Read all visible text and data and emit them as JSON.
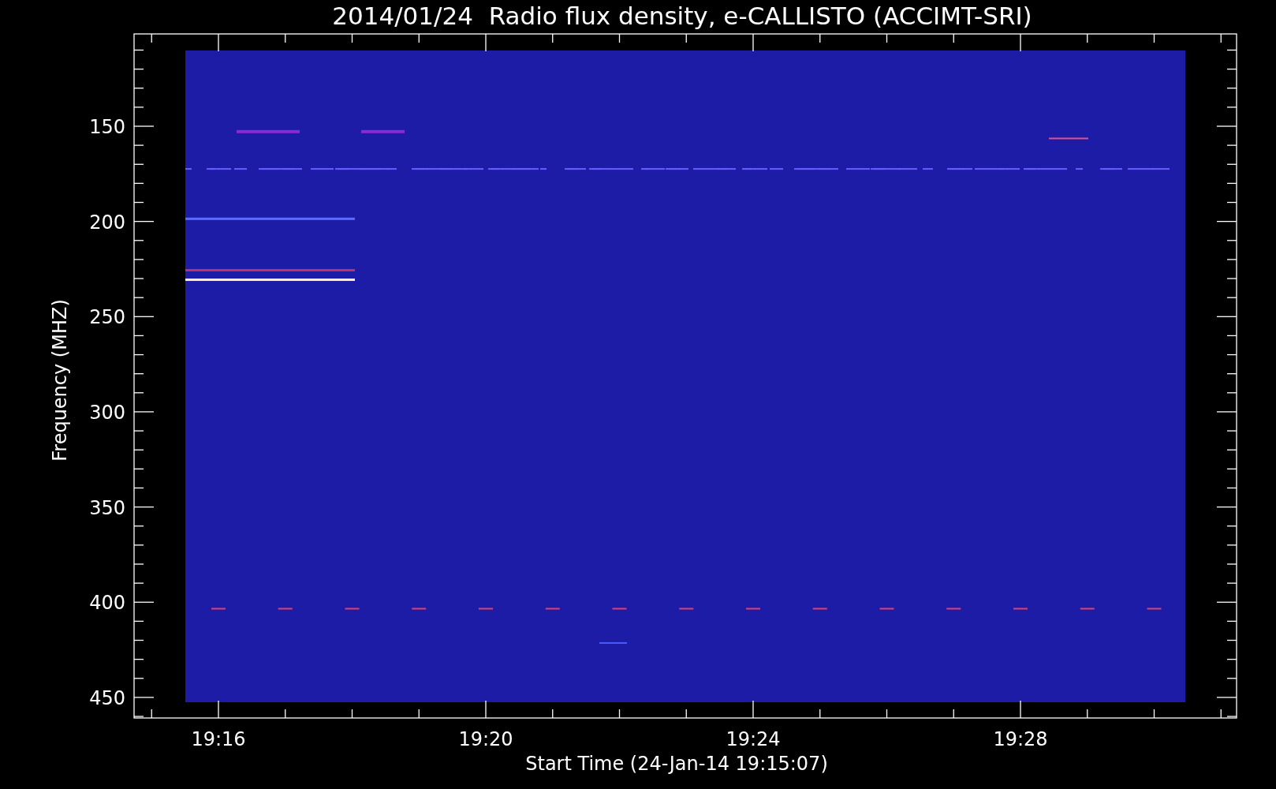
{
  "title": "2014/01/24  Radio flux density, e-CALLISTO (ACCIMT-SRI)",
  "y_axis": {
    "label": "Frequency (MHZ)",
    "ticks": [
      "150",
      "200",
      "250",
      "300",
      "350",
      "400",
      "450"
    ]
  },
  "x_axis": {
    "label": "Start Time (24-Jan-14 19:15:07)",
    "ticks": [
      "19:16",
      "19:20",
      "19:24",
      "19:28"
    ]
  }
}
